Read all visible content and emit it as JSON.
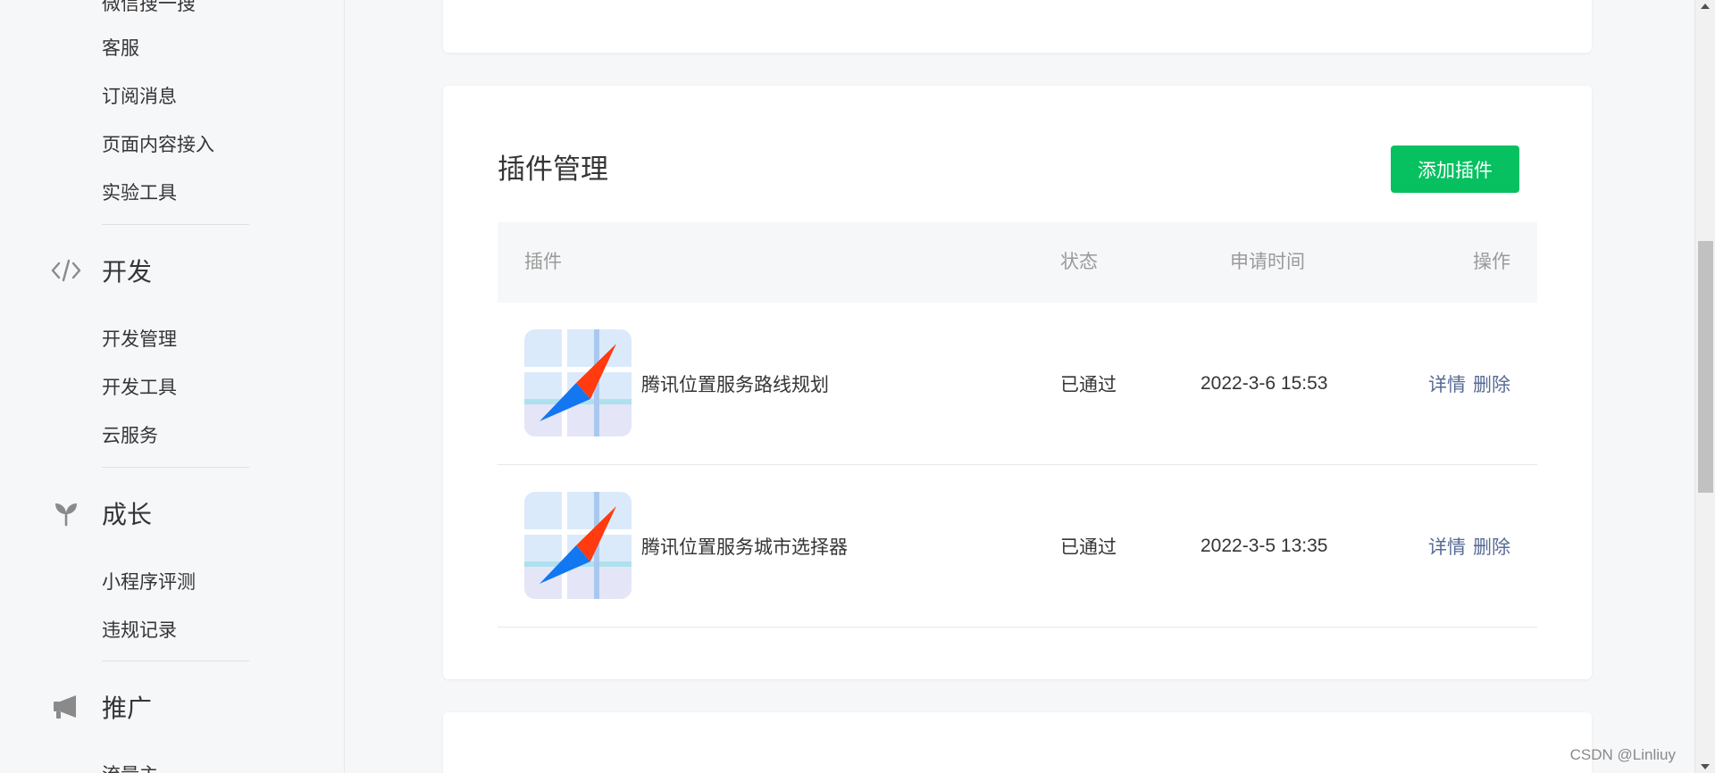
{
  "sidebar": {
    "items_top": [
      {
        "label": "微信搜一搜",
        "name": "sidebar-item-wechat-search"
      },
      {
        "label": "客服",
        "name": "sidebar-item-customer-service"
      },
      {
        "label": "订阅消息",
        "name": "sidebar-item-subscription-messages"
      },
      {
        "label": "页面内容接入",
        "name": "sidebar-item-page-content-access"
      },
      {
        "label": "实验工具",
        "name": "sidebar-item-experiment-tools"
      }
    ],
    "sections": [
      {
        "label": "开发",
        "icon": "code-icon",
        "items": [
          "开发管理",
          "开发工具",
          "云服务"
        ]
      },
      {
        "label": "成长",
        "icon": "sprout-icon",
        "items": [
          "小程序评测",
          "违规记录"
        ]
      },
      {
        "label": "推广",
        "icon": "megaphone-icon",
        "items": [
          "流量主"
        ]
      }
    ]
  },
  "main": {
    "title": "插件管理",
    "add_button": "添加插件",
    "table": {
      "headers": {
        "plugin": "插件",
        "status": "状态",
        "time": "申请时间",
        "ops": "操作"
      },
      "rows": [
        {
          "name": "腾讯位置服务路线规划",
          "status": "已通过",
          "time": "2022-3-6 15:53",
          "detail": "详情",
          "delete": "删除"
        },
        {
          "name": "腾讯位置服务城市选择器",
          "status": "已通过",
          "time": "2022-3-5 13:35",
          "detail": "详情",
          "delete": "删除"
        }
      ]
    }
  },
  "watermark": "CSDN @Linliuy",
  "colors": {
    "accent": "#07c160",
    "link": "#576b95",
    "background": "#f6f7f9"
  }
}
